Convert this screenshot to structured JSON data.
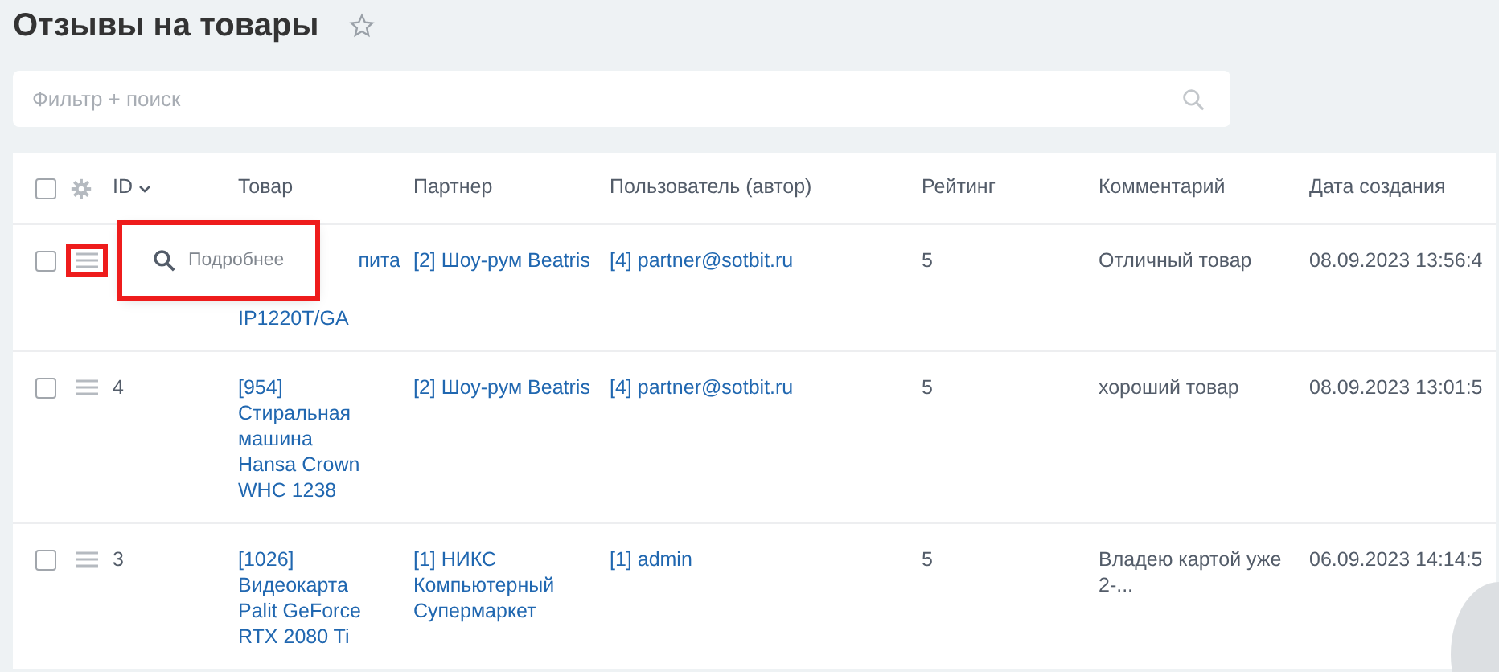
{
  "page": {
    "title": "Отзывы на товары",
    "favorite": false
  },
  "filter": {
    "placeholder": "Фильтр + поиск"
  },
  "table": {
    "columns": [
      {
        "label": "ID",
        "sorted": true
      },
      {
        "label": "Товар",
        "sorted": false
      },
      {
        "label": "Партнер",
        "sorted": false
      },
      {
        "label": "Пользователь (автор)",
        "sorted": false
      },
      {
        "label": "Рейтинг",
        "sorted": false
      },
      {
        "label": "Комментарий",
        "sorted": false
      },
      {
        "label": "Дата создания",
        "sorted": false
      }
    ],
    "all_checked": false,
    "rows": [
      {
        "checked": false,
        "menu_open": true,
        "id": "",
        "product": [
          "пита",
          "IP1220T/GA"
        ],
        "partner": "[2] Шоу-рум Beatris",
        "user": "[4] partner@sotbit.ru",
        "rating": "5",
        "comment": "Отличный товар",
        "date": "08.09.2023 13:56:4"
      },
      {
        "checked": false,
        "menu_open": false,
        "id": "4",
        "product": [
          "[954]",
          "Стиральная",
          "машина",
          "Hansa Crown",
          "WHC 1238"
        ],
        "partner": "[2] Шоу-рум Beatris",
        "user": "[4] partner@sotbit.ru",
        "rating": "5",
        "comment": "хороший товар",
        "date": "08.09.2023 13:01:5"
      },
      {
        "checked": false,
        "menu_open": false,
        "id": "3",
        "product": [
          "[1026]",
          "Видеокарта",
          "Palit GeForce",
          "RTX 2080 Ti"
        ],
        "partner": "[1] НИКС Компьютерный Супермаркет",
        "user": "[1] admin",
        "rating": "5",
        "comment": "Владею картой уже 2-...",
        "date": "06.09.2023 14:14:5"
      }
    ]
  },
  "row_menu": {
    "items": [
      {
        "label": "Подробнее"
      }
    ],
    "highlighted": true
  }
}
